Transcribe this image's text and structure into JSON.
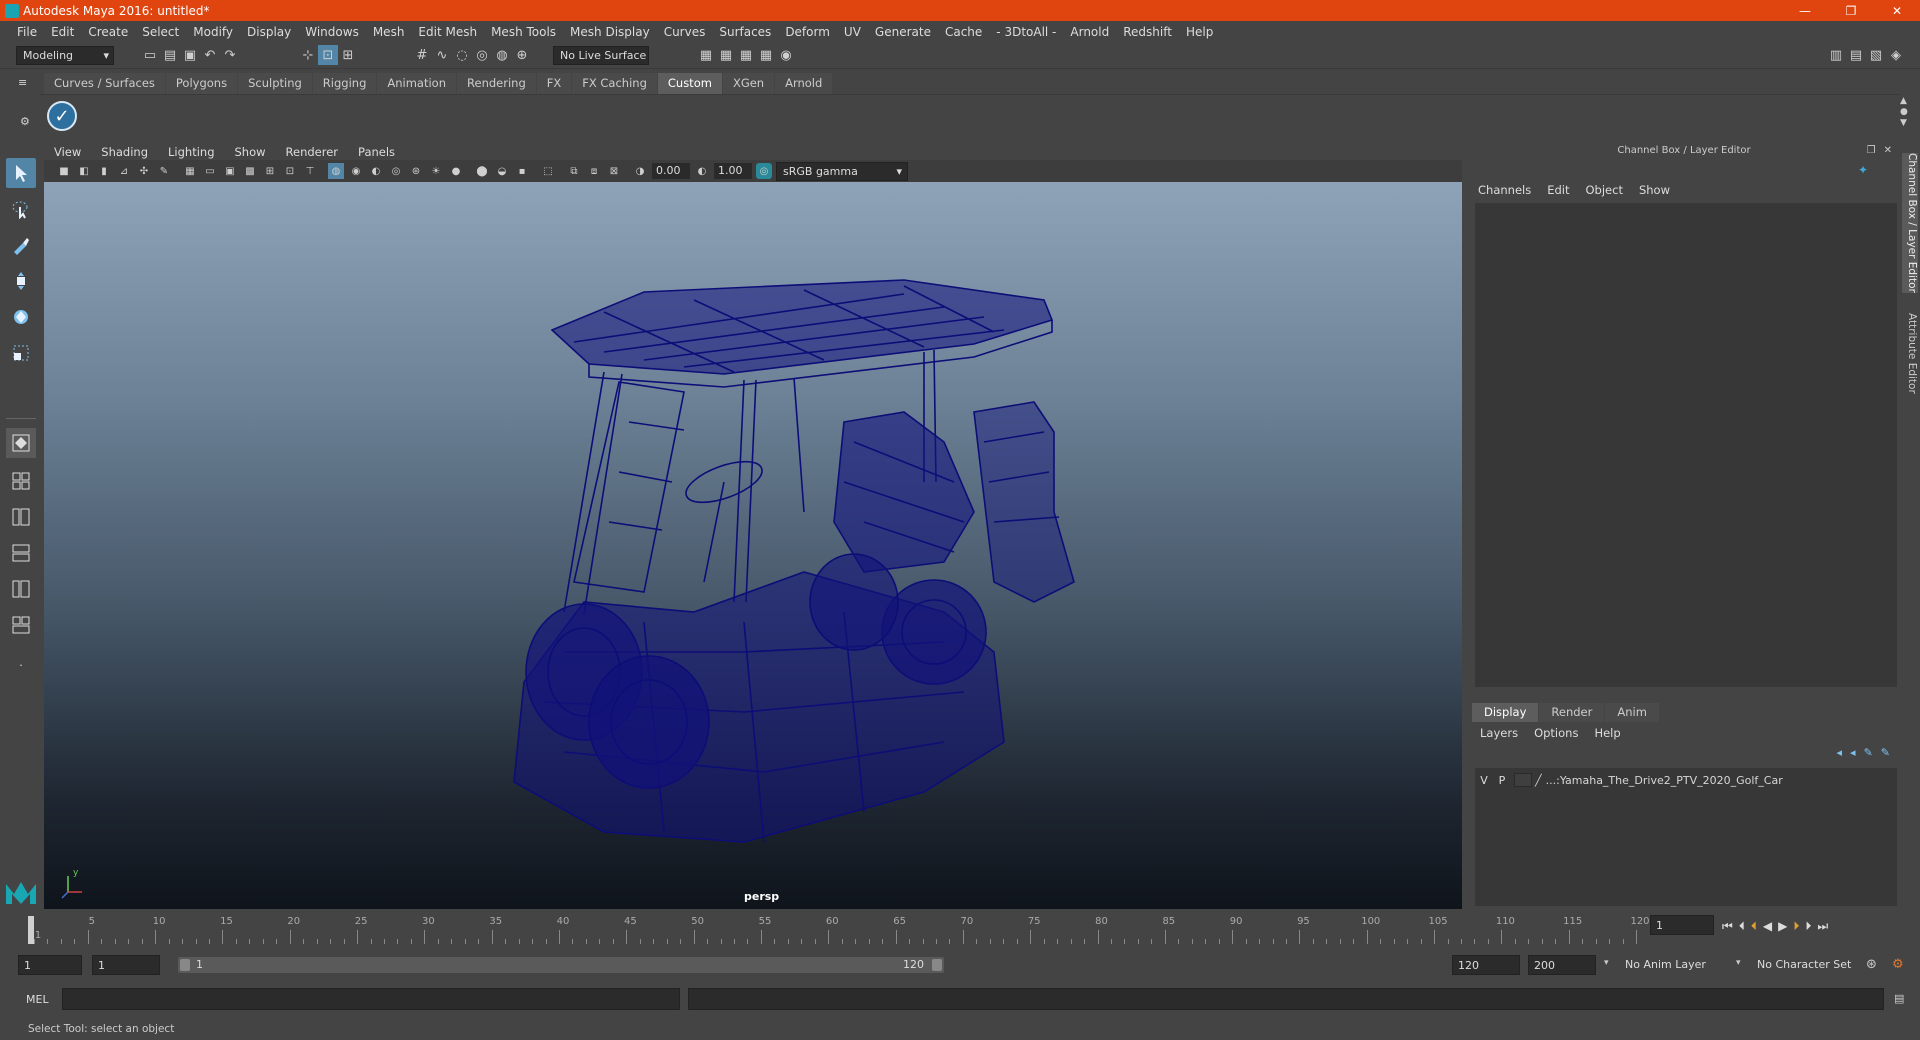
{
  "window": {
    "title": "Autodesk Maya 2016: untitled*",
    "controls": [
      "—",
      "❐",
      "✕"
    ]
  },
  "menubar": [
    "File",
    "Edit",
    "Create",
    "Select",
    "Modify",
    "Display",
    "Windows",
    "Mesh",
    "Edit Mesh",
    "Mesh Tools",
    "Mesh Display",
    "Curves",
    "Surfaces",
    "Deform",
    "UV",
    "Generate",
    "Cache",
    "- 3DtoAll -",
    "Arnold",
    "Redshift",
    "Help"
  ],
  "statusline": {
    "mode": "Modeling",
    "live_surface": "No Live Surface"
  },
  "shelf": {
    "tabs": [
      "Curves / Surfaces",
      "Polygons",
      "Sculpting",
      "Rigging",
      "Animation",
      "Rendering",
      "FX",
      "FX Caching",
      "Custom",
      "XGen",
      "Arnold"
    ],
    "active_tab": "Custom"
  },
  "viewport": {
    "menu": [
      "View",
      "Shading",
      "Lighting",
      "Show",
      "Renderer",
      "Panels"
    ],
    "exposure": "0.00",
    "gamma": "1.00",
    "color_space": "sRGB gamma",
    "camera_label": "persp",
    "axis_y": "y",
    "axis_x": "x",
    "axis_z": "z"
  },
  "channelbox": {
    "title": "Channel Box / Layer Editor",
    "menu": [
      "Channels",
      "Edit",
      "Object",
      "Show"
    ]
  },
  "layer_editor": {
    "tabs": [
      "Display",
      "Render",
      "Anim"
    ],
    "active_tab": "Display",
    "menu": [
      "Layers",
      "Options",
      "Help"
    ],
    "layers": [
      {
        "v": "V",
        "p": "P",
        "name": "...:Yamaha_The_Drive2_PTV_2020_Golf_Car"
      }
    ]
  },
  "side_tabs": [
    "Channel Box / Layer Editor",
    "Attribute Editor"
  ],
  "timeslider": {
    "labels": [
      "1",
      "5",
      "10",
      "15",
      "20",
      "25",
      "30",
      "35",
      "40",
      "45",
      "50",
      "55",
      "60",
      "65",
      "70",
      "75",
      "80",
      "85",
      "90",
      "95",
      "100",
      "105",
      "110",
      "115",
      "120"
    ],
    "current_frame": "1"
  },
  "range": {
    "start": "1",
    "playback_start": "1",
    "range_start_label": "1",
    "range_end_label": "120",
    "playback_end": "120",
    "end": "200",
    "anim_layer": "No Anim Layer",
    "character_set": "No Character Set"
  },
  "cmdline": {
    "label": "MEL"
  },
  "helpline": {
    "text": "Select Tool: select an object"
  },
  "colors": {
    "titlebar": "#e0450f",
    "active_tool": "#5285a6",
    "wireframe": "#0d0d78"
  }
}
